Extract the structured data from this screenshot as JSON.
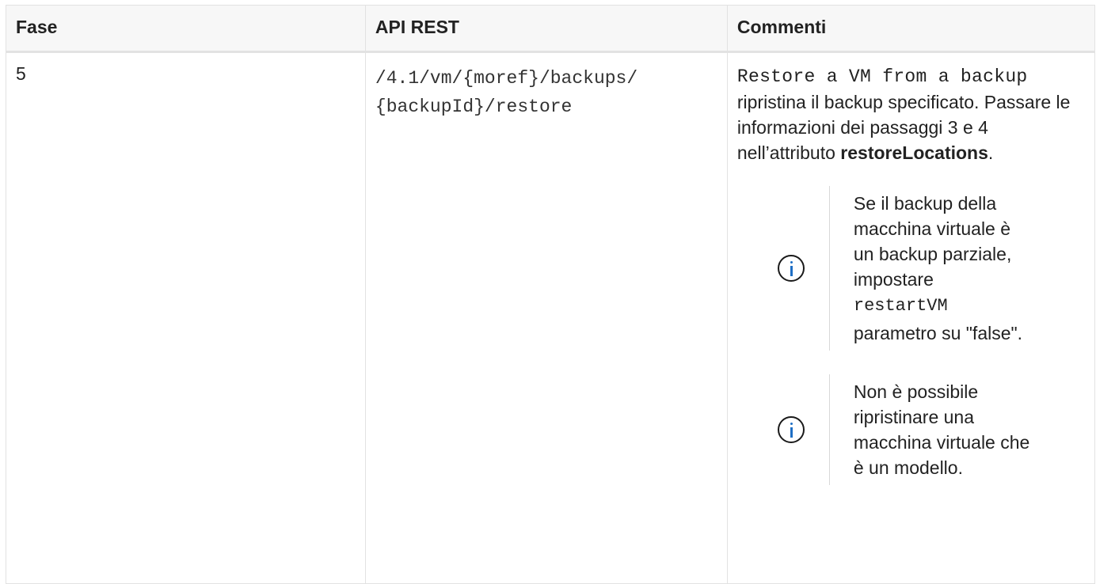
{
  "table": {
    "headers": {
      "step": "Fase",
      "api": "API REST",
      "comments": "Commenti"
    },
    "rows": [
      {
        "step": "5",
        "api_line1": "/4.1/vm/{moref}/backups/",
        "api_line2": "{backupId}/restore",
        "comment_code": "Restore a VM from a backup",
        "comment_text": "ripristina il backup specificato. Passare le informazioni dei passaggi 3 e 4 nell’attributo",
        "comment_bold": "restoreLocations",
        "comment_end": ".",
        "notes": [
          {
            "icon": "info-icon",
            "text_before": "Se il backup della macchina virtuale è un backup parziale, impostare",
            "code": "restartVM",
            "text_after": "parametro su \"false\"."
          },
          {
            "icon": "info-icon",
            "text": "Non è possibile ripristinare una macchina virtuale che è un modello."
          }
        ]
      }
    ]
  }
}
